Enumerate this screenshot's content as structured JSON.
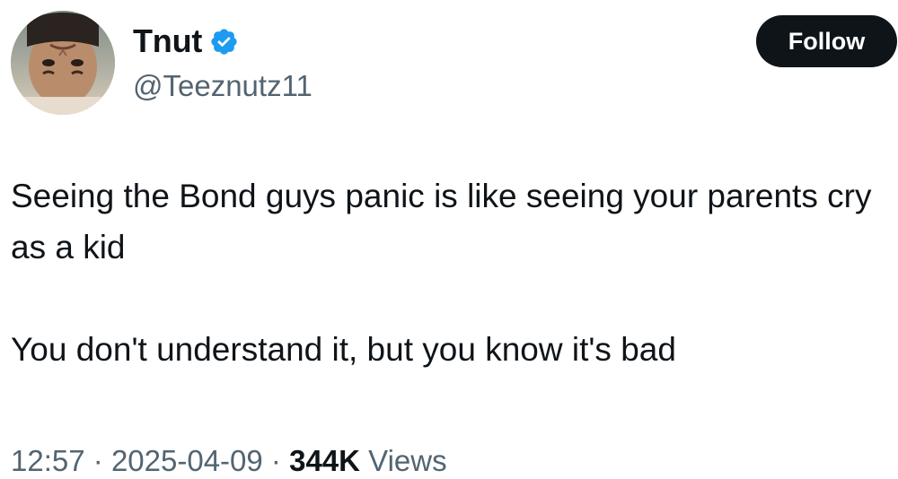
{
  "user": {
    "display_name": "Tnut",
    "handle": "@Teeznutz11",
    "verified": true,
    "verified_color": "#1d9bf0"
  },
  "follow_button": {
    "label": "Follow",
    "bg_color": "#0f1419"
  },
  "tweet": {
    "paragraphs": [
      "Seeing the Bond guys panic is like seeing your parents cry as a kid",
      "You don't understand it, but you know it's bad"
    ]
  },
  "meta": {
    "time": "12:57",
    "separator": "·",
    "date": "2025-04-09",
    "views_count": "344K",
    "views_label": "Views"
  },
  "icons": {
    "verified": "verified-badge-icon",
    "avatar": "profile-photo"
  }
}
